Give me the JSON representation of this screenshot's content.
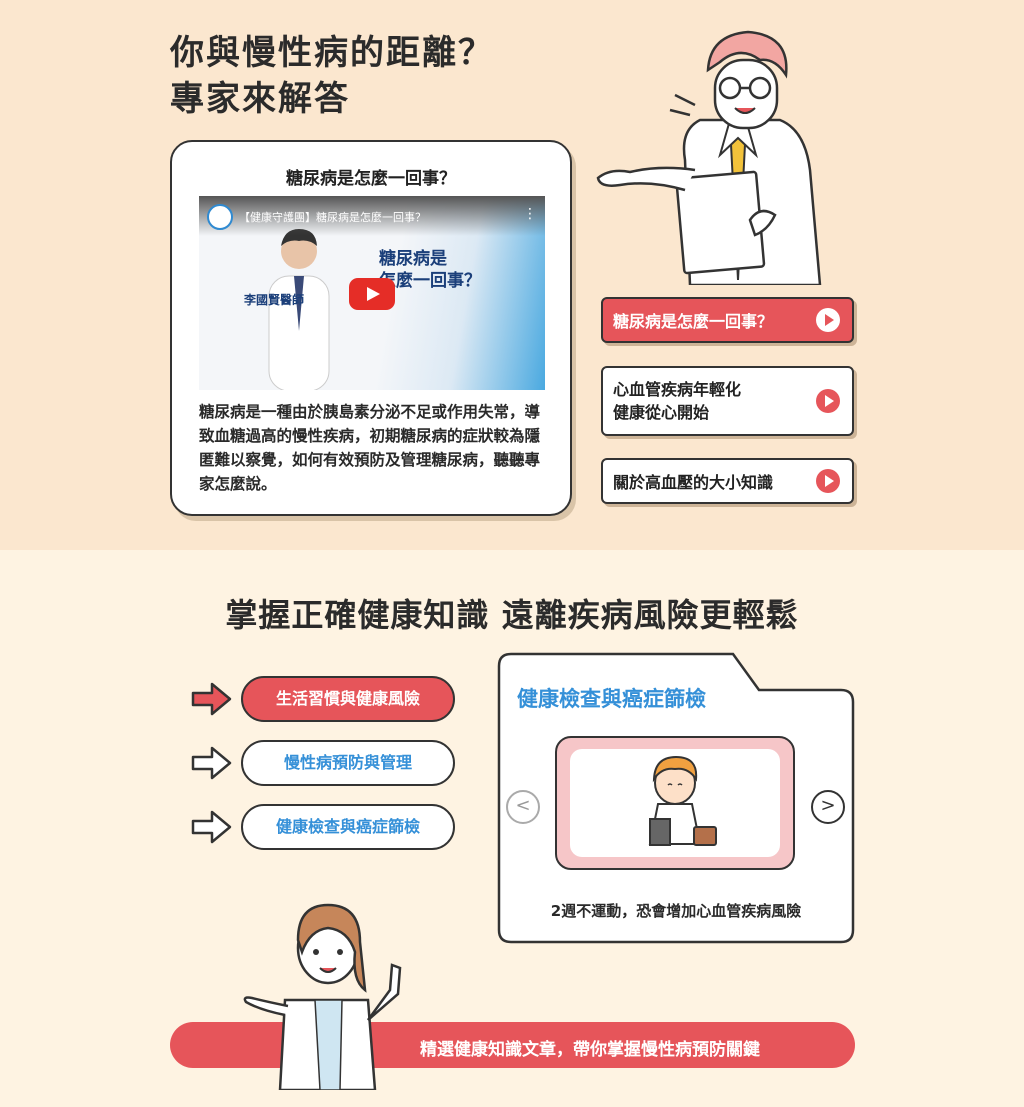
{
  "hero": {
    "title_line1": "你與慢性病的距離？",
    "title_line2": "專家來解答"
  },
  "video_card": {
    "title": "糖尿病是怎麼一回事？",
    "youtube_title": "【健康守護團】糖尿病是怎麼一回事？",
    "frame_headline_1": "糖尿病是",
    "frame_headline_2": "怎麼一回事？",
    "frame_doctor": "李國賢醫師",
    "description": "糖尿病是一種由於胰島素分泌不足或作用失常，導致血糖過高的慢性疾病，初期糖尿病的症狀較為隱匿難以察覺，如何有效預防及管理糖尿病，聽聽專家怎麼說。"
  },
  "video_links": [
    {
      "label": "糖尿病是怎麼一回事？",
      "active": true
    },
    {
      "label_line1": "心血管疾病年輕化",
      "label_line2": "健康從心開始",
      "active": false
    },
    {
      "label": "關於高血壓的大小知識",
      "active": false
    }
  ],
  "knowledge": {
    "title": "掌握正確健康知識 遠離疾病風險更輕鬆",
    "tabs": [
      {
        "label": "生活習慣與健康風險",
        "active": true
      },
      {
        "label": "慢性病預防與管理",
        "active": false
      },
      {
        "label": "健康檢查與癌症篩檢",
        "active": false
      }
    ],
    "panel_title": "健康檢查與癌症篩檢",
    "slide_caption": "2週不運動，恐會增加心血管疾病風險",
    "prev_icon": "chevron-left",
    "next_icon": "chevron-right"
  },
  "banner": {
    "text": "精選健康知識文章，帶你掌握慢性病預防關鍵"
  },
  "colors": {
    "accent_red": "#e6555a",
    "accent_blue": "#3590d8",
    "top_bg": "#fbe7cf",
    "bottom_bg": "#fef3e2"
  }
}
